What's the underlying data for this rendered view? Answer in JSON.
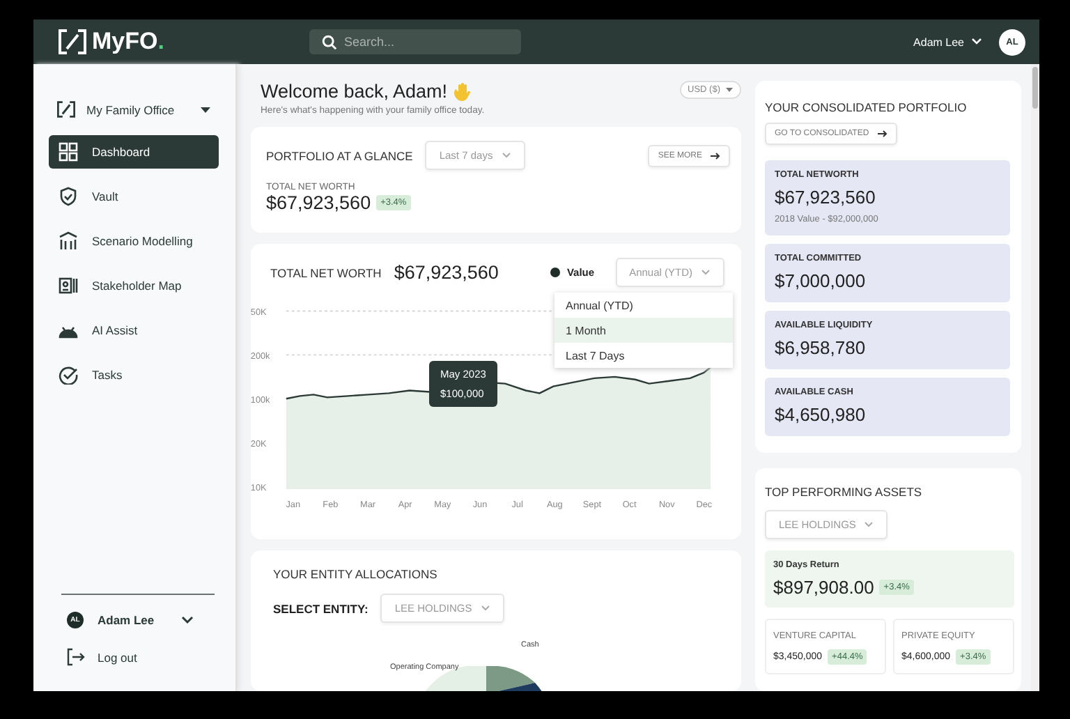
{
  "header": {
    "logo": "MyFO",
    "logo_dot": ".",
    "search": {
      "placeholder": "Search..."
    },
    "user": {
      "name": "Adam Lee",
      "initials": "AL"
    }
  },
  "sidebar": {
    "office": "My Family Office",
    "items": [
      {
        "label": "Dashboard",
        "selected": true
      },
      {
        "label": "Vault",
        "selected": false
      },
      {
        "label": "Scenario Modelling",
        "selected": false
      },
      {
        "label": "Stakeholder Map",
        "selected": false
      },
      {
        "label": "AI Assist",
        "selected": false
      },
      {
        "label": "Tasks",
        "selected": false
      }
    ],
    "user": {
      "name": "Adam Lee",
      "initials": "AL"
    },
    "logout": "Log out"
  },
  "welcome": {
    "title": "Welcome back, Adam!",
    "subtitle": "Here's what's happening with your family office today.",
    "currency": "USD ($)"
  },
  "glance": {
    "title": "PORTFOLIO AT A GLANCE",
    "period": "Last 7 days",
    "see_more": "SEE MORE",
    "label": "TOTAL NET WORTH",
    "value": "$67,923,560",
    "change": "+3.4%"
  },
  "net_worth_chart": {
    "title": "TOTAL NET WORTH",
    "value": "$67,923,560",
    "legend": "Value",
    "period": "Annual (YTD)",
    "options": [
      {
        "label": "Annual (YTD)",
        "selected": false
      },
      {
        "label": "1 Month",
        "selected": true
      },
      {
        "label": "Last 7 Days",
        "selected": false
      }
    ],
    "tooltip": {
      "date": "May 2023",
      "value": "$100,000"
    },
    "y_labels": [
      "50K",
      "200k",
      "100k",
      "20K",
      "10K"
    ],
    "x_labels": [
      "Jan",
      "Feb",
      "Mar",
      "Apr",
      "May",
      "Jun",
      "Jul",
      "Aug",
      "Sept",
      "Oct",
      "Nov",
      "Dec"
    ]
  },
  "entity": {
    "title": "YOUR ENTITY ALLOCATIONS",
    "select_label": "SELECT ENTITY:",
    "entity": "LEE HOLDINGS",
    "donut_labels": [
      "Cash",
      "Operating Company"
    ]
  },
  "consolidated": {
    "title": "YOUR CONSOLIDATED PORTFOLIO",
    "link": "GO TO CONSOLIDATED",
    "metrics": [
      {
        "label": "TOTAL NETWORTH",
        "value": "$67,923,560",
        "note": "2018 Value - $92,000,000"
      },
      {
        "label": "TOTAL COMMITTED",
        "value": "$7,000,000"
      },
      {
        "label": "AVAILABLE LIQUIDITY",
        "value": "$6,958,780"
      },
      {
        "label": "AVAILABLE CASH",
        "value": "$4,650,980"
      }
    ]
  },
  "top_assets": {
    "title": "TOP PERFORMING ASSETS",
    "entity": "LEE HOLDINGS",
    "return": {
      "label": "30 Days Return",
      "value": "$897,908.00",
      "change": "+3.4%"
    },
    "assets": [
      {
        "label": "VENTURE CAPITAL",
        "value": "$3,450,000",
        "change": "+44.4%"
      },
      {
        "label": "PRIVATE EQUITY",
        "value": "$4,600,000",
        "change": "+3.4%"
      }
    ]
  }
}
